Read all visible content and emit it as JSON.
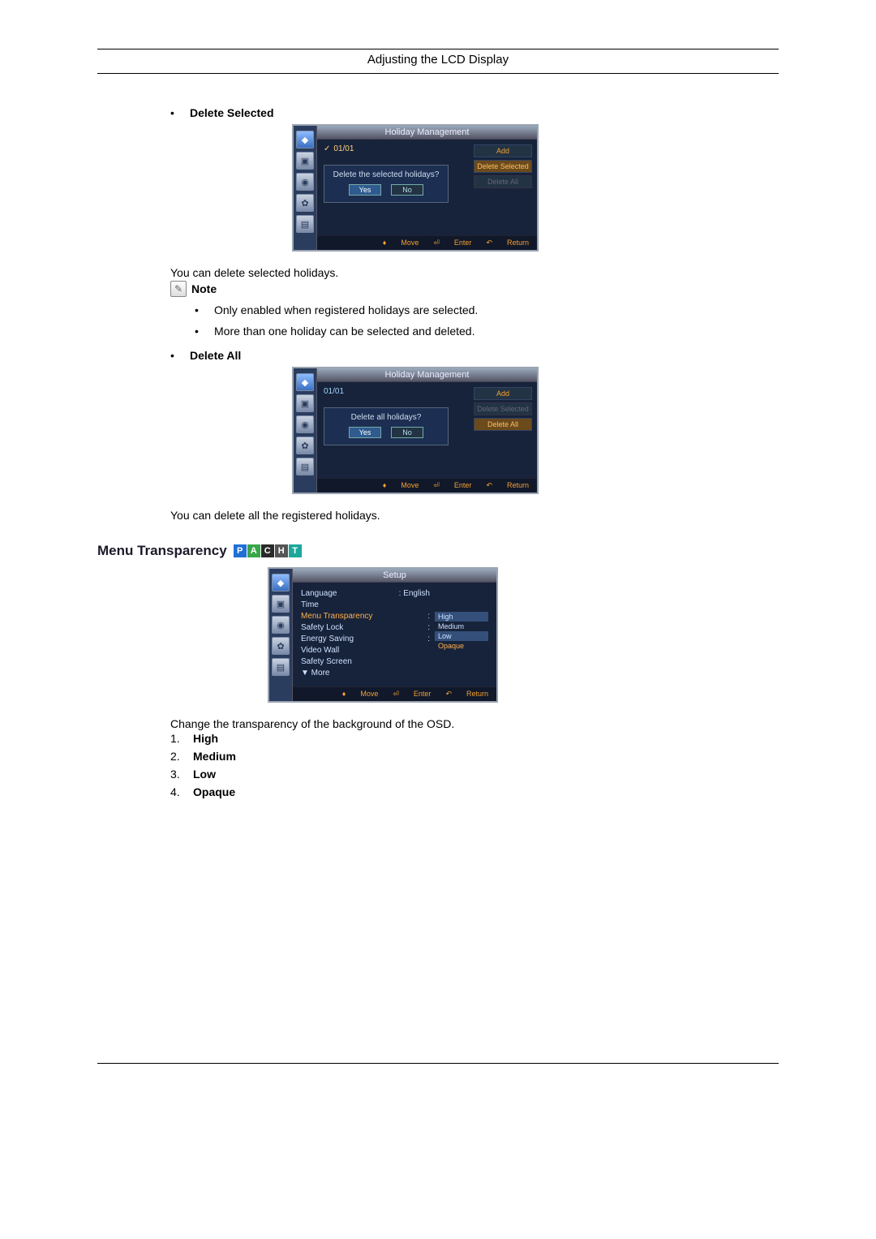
{
  "page_header": "Adjusting the LCD Display",
  "sections": {
    "delete_selected": {
      "heading": "Delete Selected",
      "desc": "You can delete selected holidays.",
      "note_label": "Note",
      "notes": [
        "Only enabled when registered holidays are selected.",
        "More than one holiday can be selected and deleted."
      ]
    },
    "delete_all": {
      "heading": "Delete All",
      "desc": "You can delete all the registered holidays."
    },
    "menu_transparency": {
      "heading": "Menu Transparency",
      "desc": "Change the transparency of the background of the OSD.",
      "options": [
        "High",
        "Medium",
        "Low",
        "Opaque"
      ]
    }
  },
  "osd": {
    "holiday_title": "Holiday Management",
    "hints": {
      "move": "Move",
      "enter": "Enter",
      "return": "Return"
    },
    "delete_selected": {
      "entry": "01/01",
      "dialog_q": "Delete the selected holidays?",
      "yes": "Yes",
      "no": "No",
      "side": {
        "add": "Add",
        "del_sel": "Delete Selected",
        "del_all": "Delete All"
      }
    },
    "delete_all": {
      "entry": "01/01",
      "dialog_q": "Delete all holidays?",
      "yes": "Yes",
      "no": "No",
      "side": {
        "add": "Add",
        "del_sel": "Delete Selected",
        "del_all": "Delete All"
      }
    },
    "setup": {
      "title": "Setup",
      "rows": {
        "language_l": "Language",
        "language_v": ": English",
        "time_l": "Time",
        "menu_trans_l": "Menu Transparency",
        "safety_lock_l": "Safety Lock",
        "energy_l": "Energy Saving",
        "video_wall_l": "Video Wall",
        "safety_screen_l": "Safety Screen",
        "more_l": "▼ More"
      },
      "opts": {
        "high": "High",
        "medium": "Medium",
        "low": "Low",
        "opaque": "Opaque"
      }
    }
  },
  "badges": [
    "P",
    "A",
    "C",
    "H",
    "T"
  ]
}
